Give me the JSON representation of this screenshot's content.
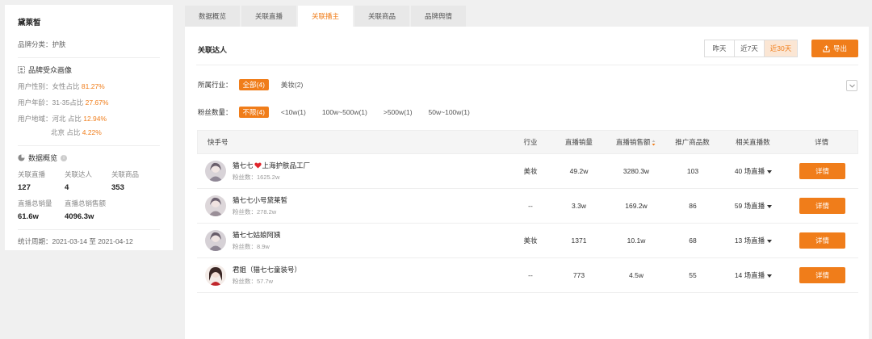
{
  "sidebar": {
    "brand_name": "黛莱皙",
    "brand_category": "品牌分类：护肤",
    "audience_title": "品牌受众画像",
    "gender_label": "用户性别：女性占比 ",
    "gender_value": "81.27%",
    "age_label": "用户年龄：31-35占比 ",
    "age_value": "27.67%",
    "region_label": "用户地域：河北 占比 ",
    "region_value": "12.94%",
    "region2_label": "北京 占比 ",
    "region2_value": "4.22%",
    "overview_title": "数据概览",
    "stats": [
      {
        "label": "关联直播",
        "value": "127"
      },
      {
        "label": "关联达人",
        "value": "4"
      },
      {
        "label": "关联商品",
        "value": "353"
      },
      {
        "label": "直播总销量",
        "value": "61.6w"
      },
      {
        "label": "直播总销售额",
        "value": "4096.3w"
      }
    ],
    "period": "统计周期：2021-03-14 至 2021-04-12"
  },
  "tabs": [
    {
      "label": "数据概览",
      "active": false
    },
    {
      "label": "关联直播",
      "active": false
    },
    {
      "label": "关联播主",
      "active": true
    },
    {
      "label": "关联商品",
      "active": false
    },
    {
      "label": "品牌舆情",
      "active": false
    }
  ],
  "main": {
    "title": "关联达人",
    "ranges": [
      "昨天",
      "近7天",
      "近30天"
    ],
    "active_range": "近30天",
    "export_label": "导出",
    "industry_label": "所属行业：",
    "industry_options": [
      "全部(4)",
      "美妆(2)"
    ],
    "fans_label": "粉丝数量：",
    "fans_options": [
      "不限(4)",
      "<10w(1)",
      "100w~500w(1)",
      ">500w(1)",
      "50w~100w(1)"
    ]
  },
  "table": {
    "headers": {
      "user": "快手号",
      "industry": "行业",
      "volume": "直播销量",
      "amount": "直播销售额",
      "products": "推广商品数",
      "lives": "相关直播数",
      "detail": "详情"
    },
    "rows": [
      {
        "name_a": "猫七七",
        "name_b": "上海护肤品工厂",
        "heart": true,
        "fans": "粉丝数：1625.2w",
        "industry": "美妆",
        "volume": "49.2w",
        "amount": "3280.3w",
        "products": "103",
        "lives": "40 场直播",
        "detail": "详情"
      },
      {
        "name_a": "猫七七小号黛莱皙",
        "name_b": "",
        "heart": false,
        "fans": "粉丝数：278.2w",
        "industry": "--",
        "volume": "3.3w",
        "amount": "169.2w",
        "products": "86",
        "lives": "59 场直播",
        "detail": "详情"
      },
      {
        "name_a": "猫七七姑娘阿姨",
        "name_b": "",
        "heart": false,
        "fans": "粉丝数：8.9w",
        "industry": "美妆",
        "volume": "1371",
        "amount": "10.1w",
        "products": "68",
        "lives": "13 场直播",
        "detail": "详情"
      },
      {
        "name_a": "君姐（猫七七童装号）",
        "name_b": "",
        "heart": false,
        "fans": "粉丝数：57.7w",
        "industry": "--",
        "volume": "773",
        "amount": "4.5w",
        "products": "55",
        "lives": "14 场直播",
        "detail": "详情"
      }
    ]
  },
  "colors": {
    "accent": "#f07d1a",
    "heart": "#e0262c"
  },
  "icons": [
    "portrait-icon",
    "chart-icon",
    "info-icon",
    "upload-icon",
    "chevron-down-icon",
    "sort-icon",
    "heart-icon",
    "caret-down-icon"
  ]
}
